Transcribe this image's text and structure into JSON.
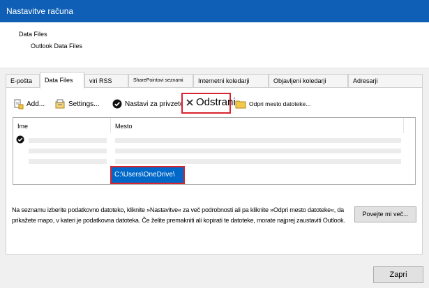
{
  "window": {
    "title": "Nastavitve računa"
  },
  "header": {
    "title": "Data Files",
    "subtitle": "Outlook Data Files"
  },
  "tabs": [
    {
      "label": "E-pošta"
    },
    {
      "label": "Data Files"
    },
    {
      "label": "viri RSS"
    },
    {
      "label": "SharePointovi seznami"
    },
    {
      "label": "Internetni koledarji"
    },
    {
      "label": "Objavljeni koledarji"
    },
    {
      "label": "Adresarji"
    }
  ],
  "toolbar": {
    "add": "Add...",
    "settings": "Settings...",
    "set_default": "Nastavi za privzeto",
    "remove": "Odstrani",
    "open_location": "Odpri mesto datoteke..."
  },
  "list": {
    "columns": [
      "Ime",
      "Mesto"
    ],
    "selected_path": "C:\\Users\\OneDrive\\"
  },
  "description": "Na seznamu izberite podatkovno datoteko, kliknite »Nastavitve« za več podrobnosti ali pa kliknite »Odpri mesto datoteke«, da prikažete mapo, v kateri je podatkovna datoteka. Če želite premakniti ali kopirati te datoteke, morate najprej zaustaviti Outlook.",
  "buttons": {
    "more": "Povejte mi več...",
    "close": "Zapri"
  },
  "colors": {
    "titlebar": "#0e5fb5",
    "selection": "#0068c9",
    "highlight": "#d9232e"
  }
}
